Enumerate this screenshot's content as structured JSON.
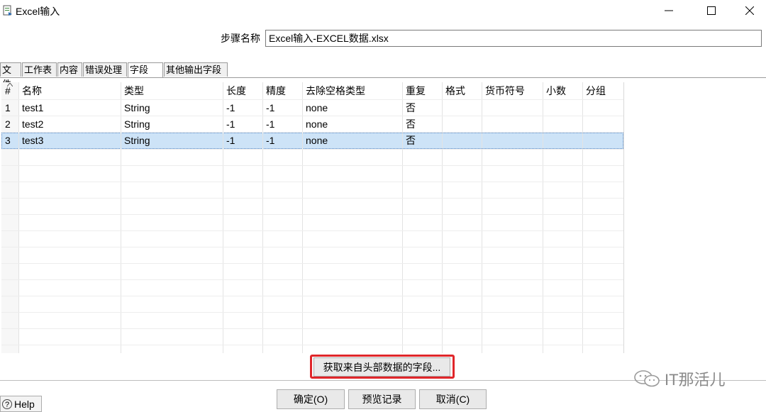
{
  "window": {
    "title": "Excel输入",
    "icon": "excel-input-icon"
  },
  "step": {
    "label": "步骤名称",
    "value": "Excel输入-EXCEL数据.xlsx"
  },
  "tabs": [
    {
      "label": "文件",
      "active": false
    },
    {
      "label": "工作表",
      "active": false
    },
    {
      "label": "内容",
      "active": false
    },
    {
      "label": "错误处理",
      "active": false
    },
    {
      "label": "字段",
      "active": true
    },
    {
      "label": "其他输出字段",
      "active": false
    }
  ],
  "table": {
    "columns": [
      "#",
      "名称",
      "类型",
      "长度",
      "精度",
      "去除空格类型",
      "重复",
      "格式",
      "货币符号",
      "小数",
      "分组"
    ],
    "rows": [
      [
        "1",
        "test1",
        "String",
        "-1",
        "-1",
        "none",
        "否",
        "",
        "",
        "",
        ""
      ],
      [
        "2",
        "test2",
        "String",
        "-1",
        "-1",
        "none",
        "否",
        "",
        "",
        "",
        ""
      ],
      [
        "3",
        "test3",
        "String",
        "-1",
        "-1",
        "none",
        "否",
        "",
        "",
        "",
        ""
      ]
    ],
    "selected_row": 3
  },
  "buttons": {
    "get_fields": "获取来自头部数据的字段...",
    "ok": "确定(O)",
    "preview": "预览记录",
    "cancel": "取消(C)",
    "help": "Help"
  },
  "watermark": {
    "text": "IT那活儿"
  },
  "colors": {
    "selection": "#cde3f7",
    "highlight_border": "#e0262a"
  }
}
